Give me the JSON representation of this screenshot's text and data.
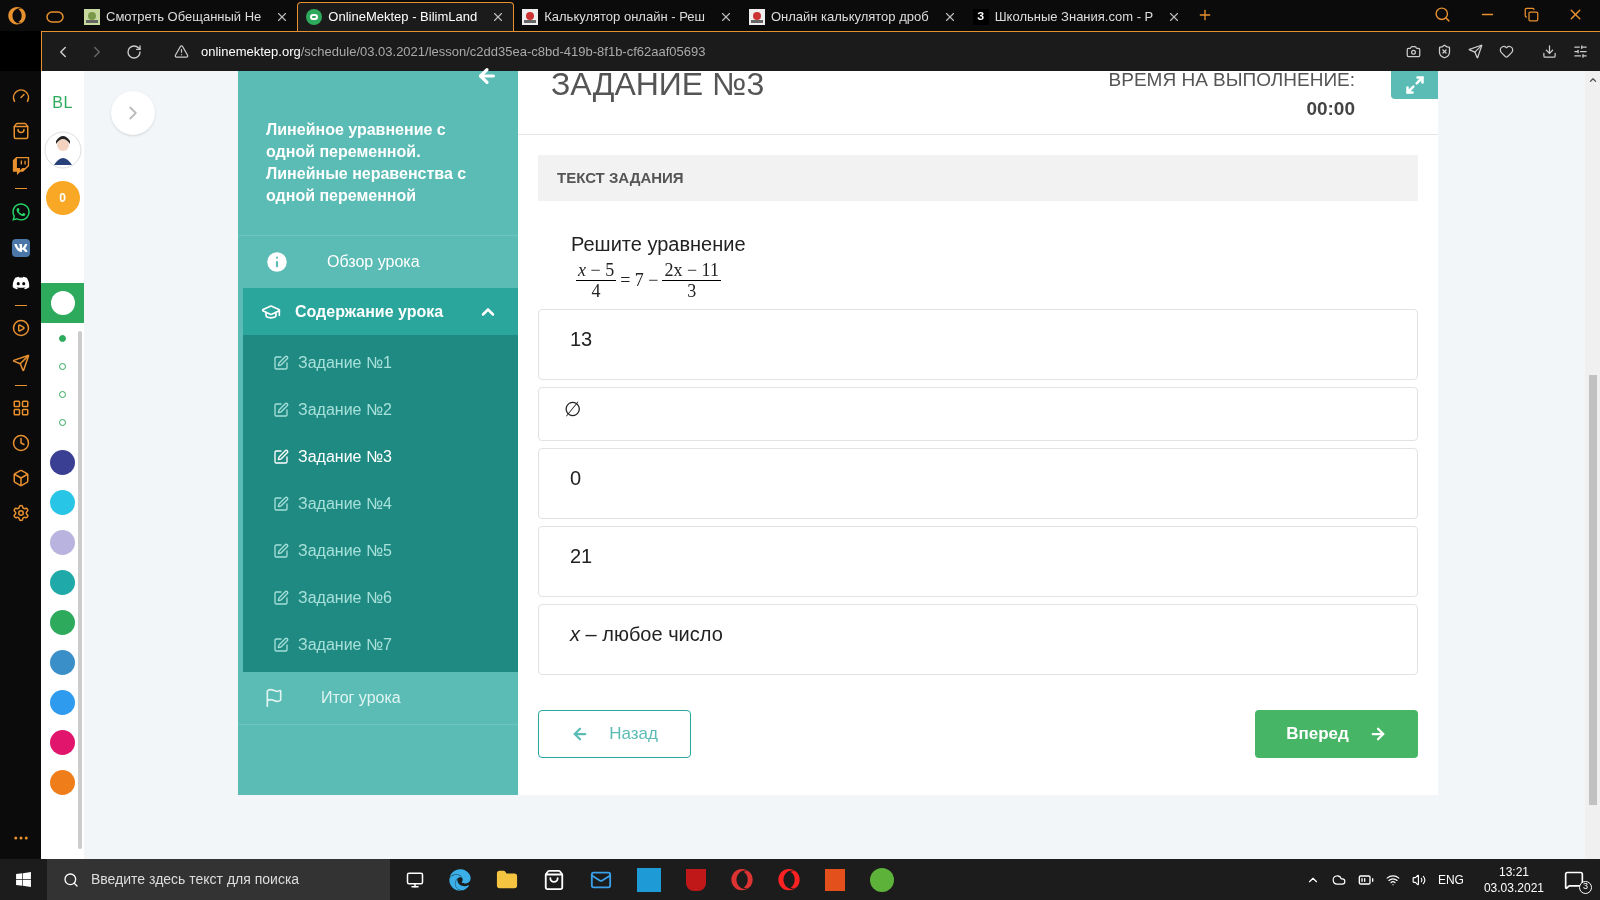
{
  "browser": {
    "tabs": [
      {
        "title": "Смотреть Обещанный Не",
        "selected": false
      },
      {
        "title": "OnlineMektep - BilimLand",
        "selected": true
      },
      {
        "title": "Калькулятор онлайн - Реш",
        "selected": false
      },
      {
        "title": "Онлайн калькулятор дроб",
        "selected": false
      },
      {
        "title": "Школьные Знания.com - Р",
        "selected": false,
        "icon_text": "З"
      }
    ],
    "address": {
      "domain": "onlinemektep.org",
      "path": "/schedule/03.03.2021/lesson/c2dd35ea-c8bd-419b-8f1b-cf62aaf05693"
    }
  },
  "site_sidebar": {
    "logo": "BL",
    "points": "0",
    "pager": [
      {
        "selected": true
      },
      {
        "selected": false
      },
      {
        "selected": false
      },
      {
        "selected": false
      }
    ],
    "apps": [
      {
        "color": "#3b3f94"
      },
      {
        "color": "#29c5e6"
      },
      {
        "color": "#b9b3e0"
      },
      {
        "color": "#1fa9a9"
      },
      {
        "color": "#2eaa5c"
      },
      {
        "color": "#3a8fc9"
      },
      {
        "color": "#2e9bef"
      },
      {
        "color": "#e0156b"
      },
      {
        "color": "#ef7d1a"
      }
    ]
  },
  "lesson_nav": {
    "title": "Линейное уравнение с одной переменной. Линейные неравенства с одной переменной",
    "items": [
      {
        "kind": "info",
        "label": "Обзор урока"
      },
      {
        "kind": "section",
        "label": "Содержание урока",
        "expanded": true,
        "children": [
          {
            "label": "Задание №1",
            "selected": false
          },
          {
            "label": "Задание №2",
            "selected": false
          },
          {
            "label": "Задание №3",
            "selected": true
          },
          {
            "label": "Задание №4",
            "selected": false
          },
          {
            "label": "Задание №5",
            "selected": false
          },
          {
            "label": "Задание №6",
            "selected": false
          },
          {
            "label": "Задание №7",
            "selected": false
          }
        ]
      },
      {
        "kind": "result",
        "label": "Итог урока",
        "disabled": true
      }
    ]
  },
  "task": {
    "title": "ЗАДАНИЕ №3",
    "timer_label": "ВРЕМЯ НА ВЫПОЛНЕНИЕ:",
    "timer": "00:00",
    "section_label": "ТЕКСТ ЗАДАНИЯ",
    "question": "Решите уравнение",
    "equation": {
      "left_num": "*x* − 5",
      "left_den": "4",
      "middle": "= 7 −",
      "right_num": "2x − 11",
      "right_den": "3"
    },
    "answers": [
      "13",
      "∅",
      "0",
      "21",
      "*x* – любое число"
    ],
    "back": "Назад",
    "forward": "Вперед"
  },
  "taskbar": {
    "search_placeholder": "Введите здесь текст для поиска",
    "language": "ENG",
    "time": "13:21",
    "date": "03.03.2021",
    "notifications": "3"
  }
}
